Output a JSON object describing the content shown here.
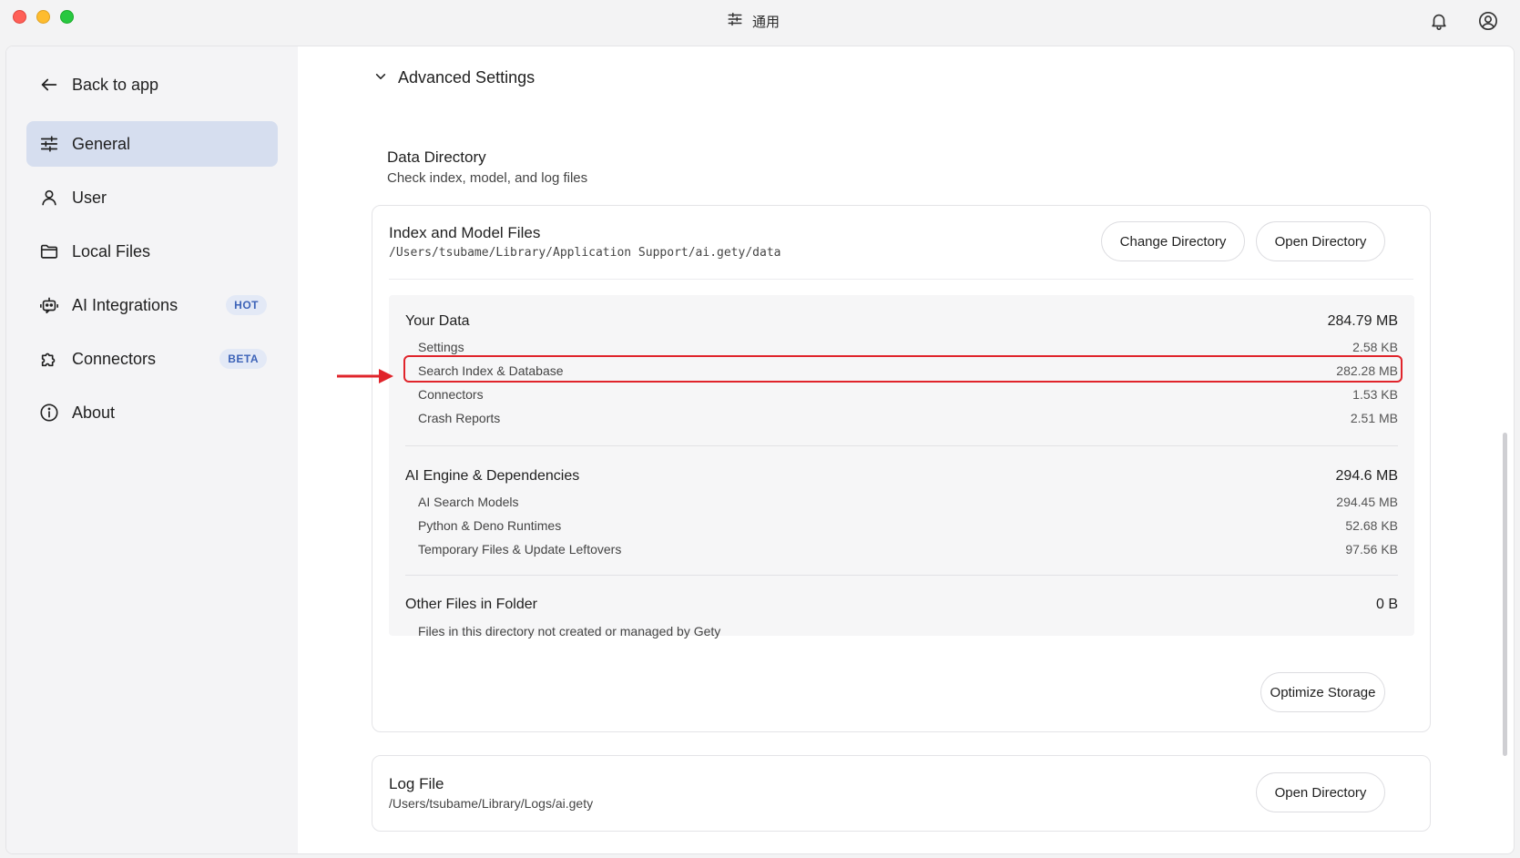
{
  "titlebar": {
    "title": "通用",
    "title_icon": "sliders-icon",
    "notification_icon": "bell-icon",
    "account_icon": "user-circle-icon"
  },
  "sidebar": {
    "back_label": "Back to app",
    "items": [
      {
        "label": "General",
        "icon": "sliders-icon",
        "active": true
      },
      {
        "label": "User",
        "icon": "user-icon"
      },
      {
        "label": "Local Files",
        "icon": "folder-icon"
      },
      {
        "label": "AI Integrations",
        "icon": "robot-icon",
        "badge": "HOT"
      },
      {
        "label": "Connectors",
        "icon": "puzzle-icon",
        "badge": "BETA"
      },
      {
        "label": "About",
        "icon": "info-icon"
      }
    ]
  },
  "main": {
    "advanced_settings_label": "Advanced Settings",
    "data_directory": {
      "title": "Data Directory",
      "subtitle": "Check index, model, and log files"
    },
    "index_files": {
      "title": "Index and Model Files",
      "path": "/Users/tsubame/Library/Application Support/ai.gety/data",
      "change_button": "Change Directory",
      "open_button": "Open Directory",
      "groups": [
        {
          "title": "Your Data",
          "total": "284.79 MB",
          "rows": [
            {
              "label": "Settings",
              "value": "2.58 KB"
            },
            {
              "label": "Search Index & Database",
              "value": "282.28 MB"
            },
            {
              "label": "Connectors",
              "value": "1.53 KB"
            },
            {
              "label": "Crash Reports",
              "value": "2.51 MB"
            }
          ]
        },
        {
          "title": "AI Engine & Dependencies",
          "total": "294.6 MB",
          "rows": [
            {
              "label": "AI Search Models",
              "value": "294.45 MB"
            },
            {
              "label": "Python & Deno Runtimes",
              "value": "52.68 KB"
            },
            {
              "label": "Temporary Files & Update Leftovers",
              "value": "97.56 KB"
            }
          ]
        },
        {
          "title": "Other Files in Folder",
          "total": "0 B",
          "description": "Files in this directory not created or managed by Gety"
        }
      ],
      "optimize_button": "Optimize Storage"
    },
    "log_file": {
      "title": "Log File",
      "path": "/Users/tsubame/Library/Logs/ai.gety",
      "open_button": "Open Directory"
    },
    "annotation": {
      "highlighted_row": "Search Index & Database",
      "color": "#e0242b"
    }
  }
}
